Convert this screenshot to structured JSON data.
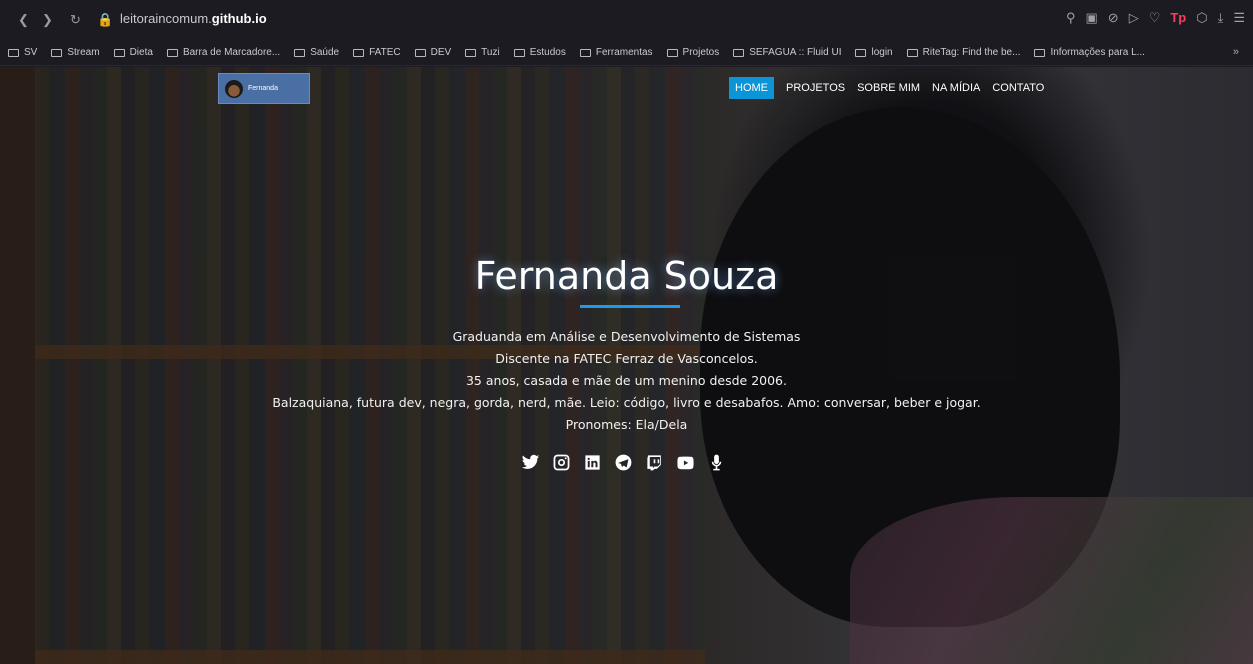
{
  "browser": {
    "url_prefix": "leitoraincomum.",
    "url_domain": "github.io",
    "bookmarks": [
      "SV",
      "Stream",
      "Dieta",
      "Barra de Marcadore...",
      "Saúde",
      "FATEC",
      "DEV",
      "Tuzi",
      "Estudos",
      "Ferramentas",
      "Projetos",
      "SEFAGUA :: Fluid UI",
      "login",
      "RiteTag: Find the be...",
      "Informações para L..."
    ],
    "more": "»"
  },
  "site": {
    "logo_text": "Fernanda",
    "nav": [
      "HOME",
      "PROJETOS",
      "SOBRE MIM",
      "NA MÍDIA",
      "CONTATO"
    ],
    "active_nav": "HOME"
  },
  "hero": {
    "name": "Fernanda Souza",
    "lines": [
      "Graduanda em Análise e Desenvolvimento de Sistemas",
      "Discente na FATEC Ferraz de Vasconcelos.",
      "35 anos, casada e mãe de um menino desde 2006.",
      "Balzaquiana, futura dev, negra, gorda, nerd, mãe. Leio: código, livro e desabafos. Amo: conversar, beber e jogar.",
      "Pronomes: Ela/Dela"
    ],
    "social_icons": [
      "twitter-icon",
      "instagram-icon",
      "linkedin-icon",
      "telegram-icon",
      "twitch-icon",
      "youtube-icon",
      "podcast-icon"
    ]
  }
}
